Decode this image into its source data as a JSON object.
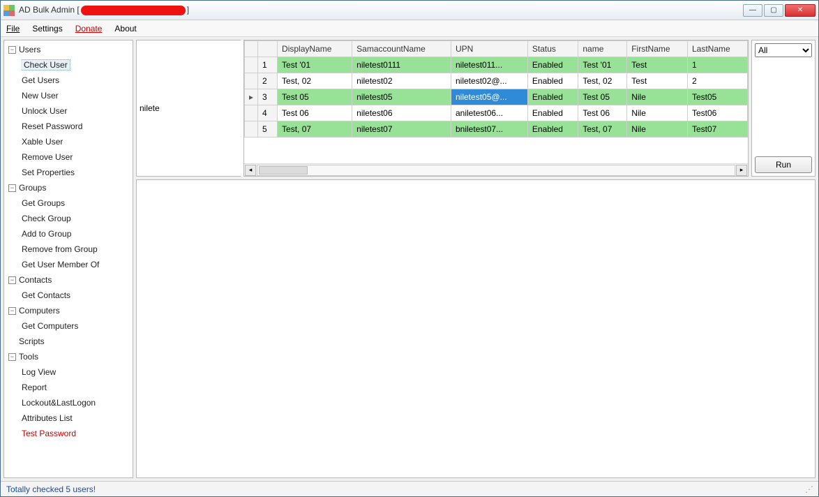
{
  "window": {
    "title_prefix": "AD Bulk Admin [",
    "title_suffix": "]"
  },
  "menu": {
    "file": "File",
    "settings": "Settings",
    "donate": "Donate",
    "about": "About"
  },
  "tree": {
    "users": {
      "label": "Users",
      "items": [
        "Check User",
        "Get Users",
        "New User",
        "Unlock User",
        "Reset Password",
        "Xable User",
        "Remove User",
        "Set Properties"
      ]
    },
    "groups": {
      "label": "Groups",
      "items": [
        "Get Groups",
        "Check Group",
        "Add to Group",
        "Remove from Group",
        "Get User Member Of"
      ]
    },
    "contacts": {
      "label": "Contacts",
      "items": [
        "Get Contacts"
      ]
    },
    "computers": {
      "label": "Computers",
      "items": [
        "Get Computers"
      ]
    },
    "scripts": {
      "label": "Scripts"
    },
    "tools": {
      "label": "Tools",
      "items": [
        "Log View",
        "Report",
        "Lockout&LastLogon",
        "Attributes List",
        "Test Password"
      ]
    }
  },
  "search": {
    "value": "nilete"
  },
  "filter": {
    "selected": "All"
  },
  "run_button": "Run",
  "grid": {
    "columns": [
      "DisplayName",
      "SamaccountName",
      "UPN",
      "Status",
      "name",
      "FirstName",
      "LastName"
    ],
    "rows": [
      {
        "n": "1",
        "marker": "",
        "green": true,
        "cells": [
          "Test '01",
          "niletest0111",
          "niletest011...",
          "Enabled",
          "Test '01",
          "Test",
          "1"
        ]
      },
      {
        "n": "2",
        "marker": "",
        "green": false,
        "cells": [
          "Test, 02",
          "niletest02",
          "niletest02@...",
          "Enabled",
          "Test, 02",
          "Test",
          "2"
        ]
      },
      {
        "n": "3",
        "marker": "▸",
        "green": true,
        "cells": [
          "Test 05",
          "niletest05",
          "niletest05@...",
          "Enabled",
          "Test 05",
          "Nile",
          "Test05"
        ],
        "sel": 2
      },
      {
        "n": "4",
        "marker": "",
        "green": false,
        "cells": [
          "Test 06",
          "niletest06",
          "aniletest06...",
          "Enabled",
          "Test 06",
          "Nile",
          "Test06"
        ]
      },
      {
        "n": "5",
        "marker": "",
        "green": true,
        "cells": [
          "Test, 07",
          "niletest07",
          "bniletest07...",
          "Enabled",
          "Test, 07",
          "Nile",
          "Test07"
        ]
      }
    ]
  },
  "status": {
    "text": "Totally checked 5 users!"
  }
}
